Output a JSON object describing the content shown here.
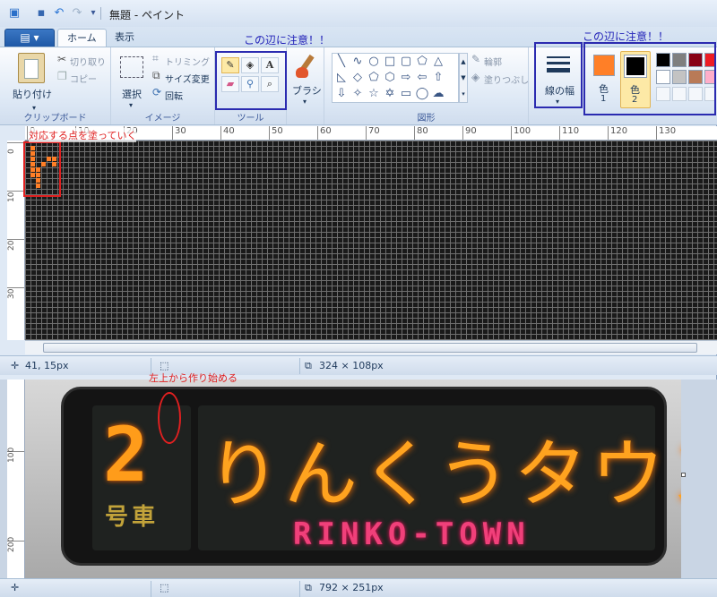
{
  "titlebar": {
    "title": "無題 - ペイント",
    "save_icon": "save-icon",
    "undo_icon": "undo-icon",
    "redo_icon": "redo-icon",
    "customize_icon": "dropdown-icon"
  },
  "tabs": {
    "file": "▤ ▾",
    "home": "ホーム",
    "view": "表示"
  },
  "ribbon": {
    "clipboard": {
      "label": "クリップボード",
      "paste": "貼り付け",
      "cut": "切り取り",
      "copy": "コピー"
    },
    "image": {
      "label": "イメージ",
      "select": "選択",
      "crop": "トリミング",
      "resize": "サイズ変更",
      "rotate": "回転"
    },
    "tools": {
      "label": "ツール",
      "items": [
        "pencil",
        "fill",
        "text",
        "eraser",
        "color-picker",
        "magnifier"
      ]
    },
    "brush": {
      "label": "ブラシ"
    },
    "shapes": {
      "label": "図形",
      "outline": "輪郭",
      "fill": "塗りつぶし"
    },
    "size": {
      "label": "線の幅"
    },
    "colors": {
      "color1_label": "色",
      "color1_num": "1",
      "color2_label": "色",
      "color2_num": "2",
      "color1_value": "#ff7f27",
      "color2_value": "#000000",
      "palette": [
        "#000000",
        "#7f7f7f",
        "#880015",
        "#ffffff",
        "#c3c3c3",
        "#b97a57",
        "#ffffff",
        "#ffffff",
        "#ffffff"
      ]
    }
  },
  "annotations": {
    "note_tools": "この辺に注意！！",
    "note_colors": "この辺に注意！！",
    "note_canvas": "対応する点を塗っていく",
    "note_photo": "左上から作り始める"
  },
  "ruler": {
    "h_ticks": [
      "0",
      "10",
      "20",
      "30",
      "40",
      "50",
      "60",
      "70",
      "80",
      "90",
      "100",
      "110",
      "120",
      "130"
    ],
    "v_ticks": [
      "0",
      "10",
      "20",
      "30"
    ],
    "v2_ticks": [
      "100",
      "200"
    ]
  },
  "status1": {
    "cursor_pos": "41, 15px",
    "image_size": "324 × 108px"
  },
  "status2": {
    "image_size": "792 × 251px"
  },
  "photo": {
    "car_number": "2",
    "car_label": "号車",
    "destination_jp": "りんくうタウン",
    "destination_en": "RINKO-TOWN"
  }
}
